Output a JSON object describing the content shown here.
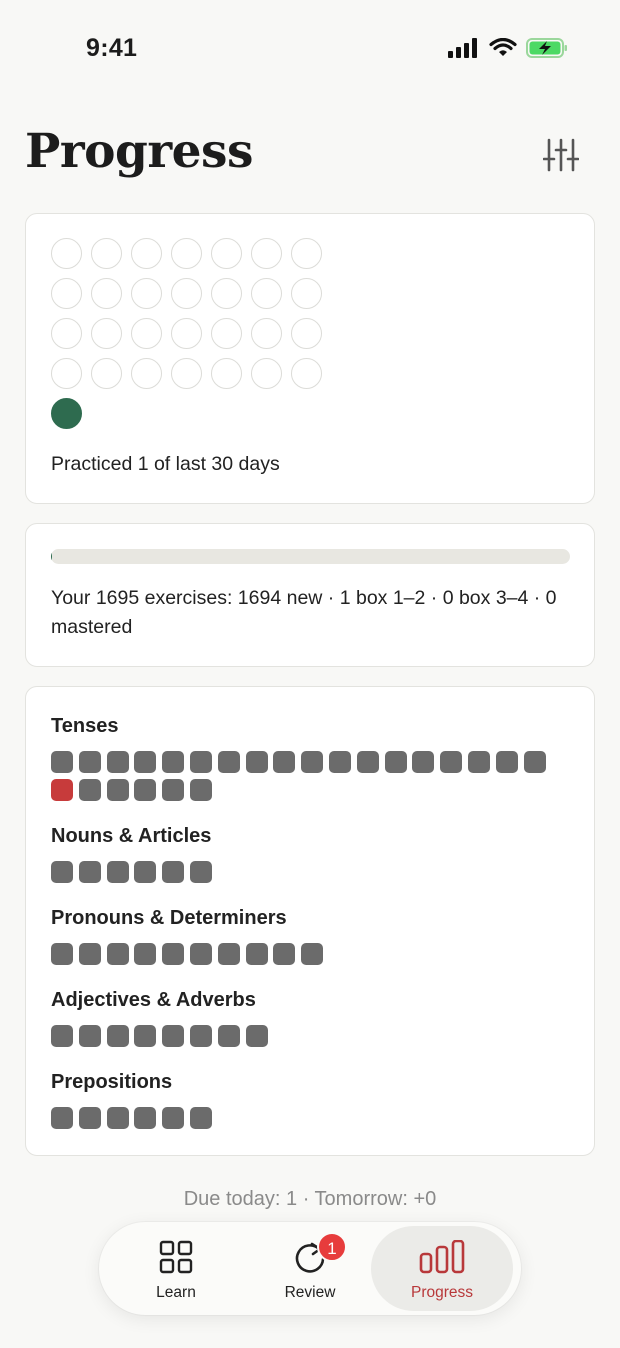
{
  "status_bar": {
    "time": "9:41"
  },
  "header": {
    "title": "Progress"
  },
  "calendar": {
    "days": [
      0,
      0,
      0,
      0,
      0,
      0,
      0,
      0,
      0,
      0,
      0,
      0,
      0,
      0,
      0,
      0,
      0,
      0,
      0,
      0,
      0,
      0,
      0,
      0,
      0,
      0,
      0,
      0,
      1
    ],
    "caption": "Practiced 1 of last 30 days",
    "done_color": "#2e6b4f"
  },
  "exercises": {
    "progress_fraction": 0.0006,
    "summary": "Your 1695 exercises: 1694 new · 1 box 1–2 · 0 box 3–4 · 0 mastered"
  },
  "categories": [
    {
      "title": "Tenses",
      "squares": [
        "gray",
        "gray",
        "gray",
        "gray",
        "gray",
        "gray",
        "gray",
        "gray",
        "gray",
        "gray",
        "gray",
        "gray",
        "gray",
        "gray",
        "gray",
        "gray",
        "gray",
        "gray",
        "red",
        "gray",
        "gray",
        "gray",
        "gray",
        "gray"
      ]
    },
    {
      "title": "Nouns & Articles",
      "squares": [
        "gray",
        "gray",
        "gray",
        "gray",
        "gray",
        "gray"
      ]
    },
    {
      "title": "Pronouns & Determiners",
      "squares": [
        "gray",
        "gray",
        "gray",
        "gray",
        "gray",
        "gray",
        "gray",
        "gray",
        "gray",
        "gray"
      ]
    },
    {
      "title": "Adjectives & Adverbs",
      "squares": [
        "gray",
        "gray",
        "gray",
        "gray",
        "gray",
        "gray",
        "gray",
        "gray"
      ]
    },
    {
      "title": "Prepositions",
      "squares": [
        "gray",
        "gray",
        "gray",
        "gray",
        "gray",
        "gray"
      ]
    }
  ],
  "due": {
    "text": "Due today: 1 · Tomorrow: +0"
  },
  "tab_bar": {
    "tabs": [
      {
        "label": "Learn",
        "icon": "grid-icon"
      },
      {
        "label": "Review",
        "icon": "refresh-icon",
        "badge": "1"
      },
      {
        "label": "Progress",
        "icon": "bar-chart-icon",
        "active": true
      }
    ],
    "accent_color": "#b8383a",
    "badge_color": "#e73c3c"
  }
}
